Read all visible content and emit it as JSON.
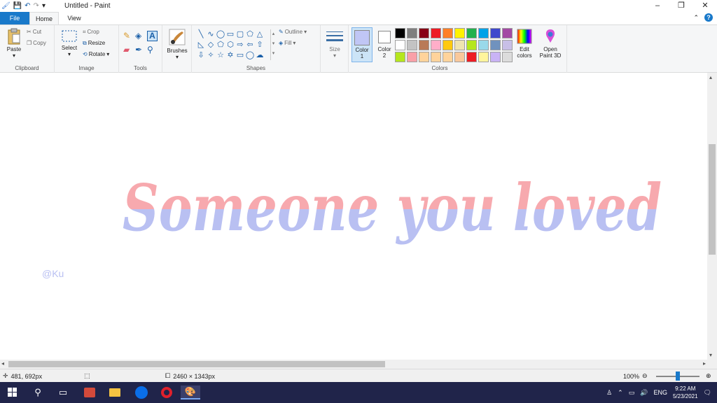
{
  "window": {
    "title": "Untitled - Paint",
    "controls": [
      "–",
      "❐",
      "✕"
    ]
  },
  "tabs": [
    "File",
    "Home",
    "View"
  ],
  "ribbon": {
    "clipboard": {
      "label": "Clipboard",
      "paste": "Paste",
      "cut": "Cut",
      "copy": "Copy"
    },
    "image": {
      "label": "Image",
      "select": "Select",
      "crop": "Crop",
      "resize": "Resize",
      "rotate": "Rotate"
    },
    "tools": {
      "label": "Tools"
    },
    "brushes": {
      "label": "Brushes"
    },
    "shapes": {
      "label": "Shapes",
      "outline": "Outline",
      "fill": "Fill"
    },
    "size": {
      "label": "Size"
    },
    "colors": {
      "label": "Colors",
      "color1": "Color",
      "color1_num": "1",
      "color2": "Color",
      "color2_num": "2",
      "edit": "Edit",
      "edit2": "colors",
      "open": "Open",
      "open2": "Paint 3D",
      "color1_value": "#c0c6f5",
      "color2_value": "#ffffff",
      "palette": [
        "#000000",
        "#7f7f7f",
        "#880015",
        "#ed1c24",
        "#ff7f27",
        "#fff200",
        "#22b14c",
        "#00a2e8",
        "#3f48cc",
        "#a349a4",
        "#ffffff",
        "#c3c3c3",
        "#b97a57",
        "#ffaec9",
        "#ffc90e",
        "#efe4b0",
        "#b5e61d",
        "#99d9ea",
        "#7092be",
        "#c8bfe7",
        "#b5e61d",
        "#f9a0a8",
        "#ffd39b",
        "#ffd39b",
        "#ffd39b",
        "#f9c89b",
        "#ed1c24",
        "#fff59d",
        "#c9b3f5",
        "#dcdcdc"
      ]
    }
  },
  "canvas": {
    "artwork_text": "Someone you loved",
    "watermark": "@Ku",
    "top_color": "#f7a9ae",
    "bottom_color": "#b9c0f2"
  },
  "status": {
    "cursor_pos": "481, 692px",
    "image_size": "2460 × 1343px",
    "zoom": "100%"
  },
  "taskbar": {
    "lang": "ENG",
    "time": "9:22 AM",
    "date": "5/23/2021"
  }
}
